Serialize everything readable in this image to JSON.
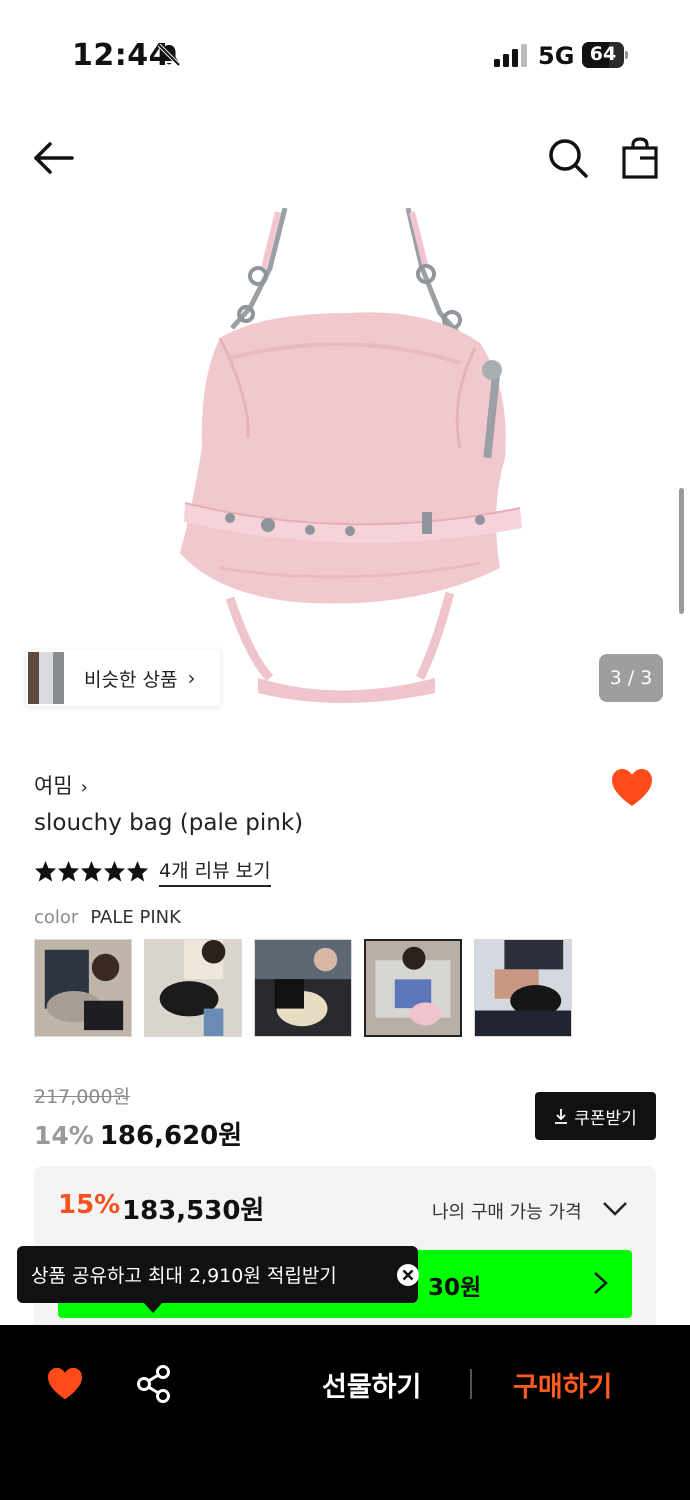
{
  "status_bar": {
    "time": "12:44",
    "network": "5G",
    "battery": "64",
    "battery_level_pct": 64
  },
  "nav": {
    "back_icon": "arrow-left-icon",
    "search_icon": "search-icon",
    "bag_icon": "shopping-bag-icon"
  },
  "hero": {
    "page_counter": "3 / 3",
    "similar_label": "비슷한 상품",
    "similar_chevron": "›"
  },
  "product": {
    "brand": "여밈",
    "brand_chevron": "›",
    "title": "slouchy bag (pale pink)",
    "rating_stars": 5,
    "review_link": "4개 리뷰 보기",
    "color_key": "color",
    "color_value": "PALE PINK",
    "swatch_count": 5,
    "selected_swatch_index": 3
  },
  "pricing": {
    "original_price": "217,000원",
    "discount_pct": "14%",
    "sale_price": "186,620원",
    "coupon_label": "쿠폰받기",
    "best_pct": "15%",
    "best_price": "183,530원",
    "my_price_label": "나의 구매 가능 가격",
    "green_bar_text": "30원"
  },
  "tooltip": {
    "text": "상품 공유하고 최대 2,910원 적립받기"
  },
  "bottom_bar": {
    "gift_label": "선물하기",
    "buy_label": "구매하기"
  },
  "colors": {
    "accent_orange": "#f4511e",
    "buy_orange": "#ff5a1f",
    "heart": "#ff4a1a",
    "green": "#00ff00",
    "bag_pink": "#f2c8cf"
  }
}
